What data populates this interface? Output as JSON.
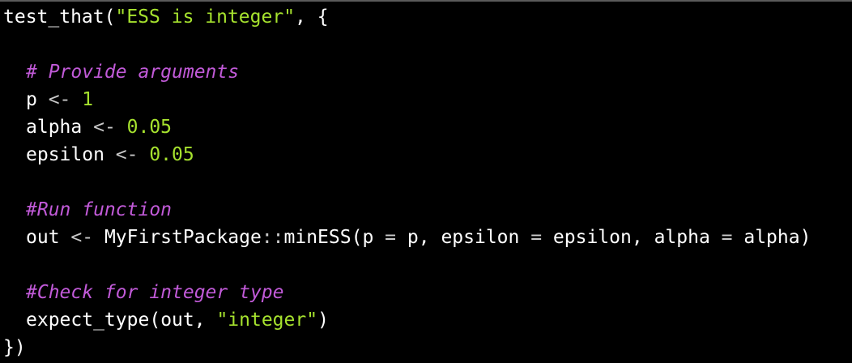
{
  "editor": {
    "lines": {
      "l1": {
        "fn": "test_that",
        "open": "(",
        "str": "\"ESS is integer\"",
        "rest": ", {"
      },
      "l3": {
        "comment": "# Provide arguments"
      },
      "l4": {
        "name": "p",
        "op": " <- ",
        "num": "1"
      },
      "l5": {
        "name": "alpha",
        "op": " <- ",
        "num": "0.05"
      },
      "l6": {
        "name": "epsilon",
        "op": " <- ",
        "num": "0.05"
      },
      "l8": {
        "comment": "#Run function"
      },
      "l9": {
        "a": "out",
        "op1": " <- ",
        "pkg": "MyFirstPackage",
        "ns": "::",
        "fn": "minESS",
        "open": "(",
        "arg1": "p",
        "eq1": " = ",
        "val1": "p",
        "c1": ", ",
        "arg2": "epsilon",
        "eq2": " = ",
        "val2": "epsilon",
        "c2": ", ",
        "arg3": "alpha",
        "eq3": " = ",
        "val3": "alpha",
        "close": ")"
      },
      "l11": {
        "comment": "#Check for integer type"
      },
      "l12": {
        "fn": "expect_type",
        "open": "(",
        "arg": "out",
        "comma": ", ",
        "str": "\"integer\"",
        "close": ")"
      },
      "l13": {
        "text": "})"
      }
    },
    "colors": {
      "background": "#000000",
      "plain": "#ffffff",
      "string_number": "#a6e22e",
      "comment": "#c15ad8",
      "operator": "#c8c8c8"
    }
  }
}
